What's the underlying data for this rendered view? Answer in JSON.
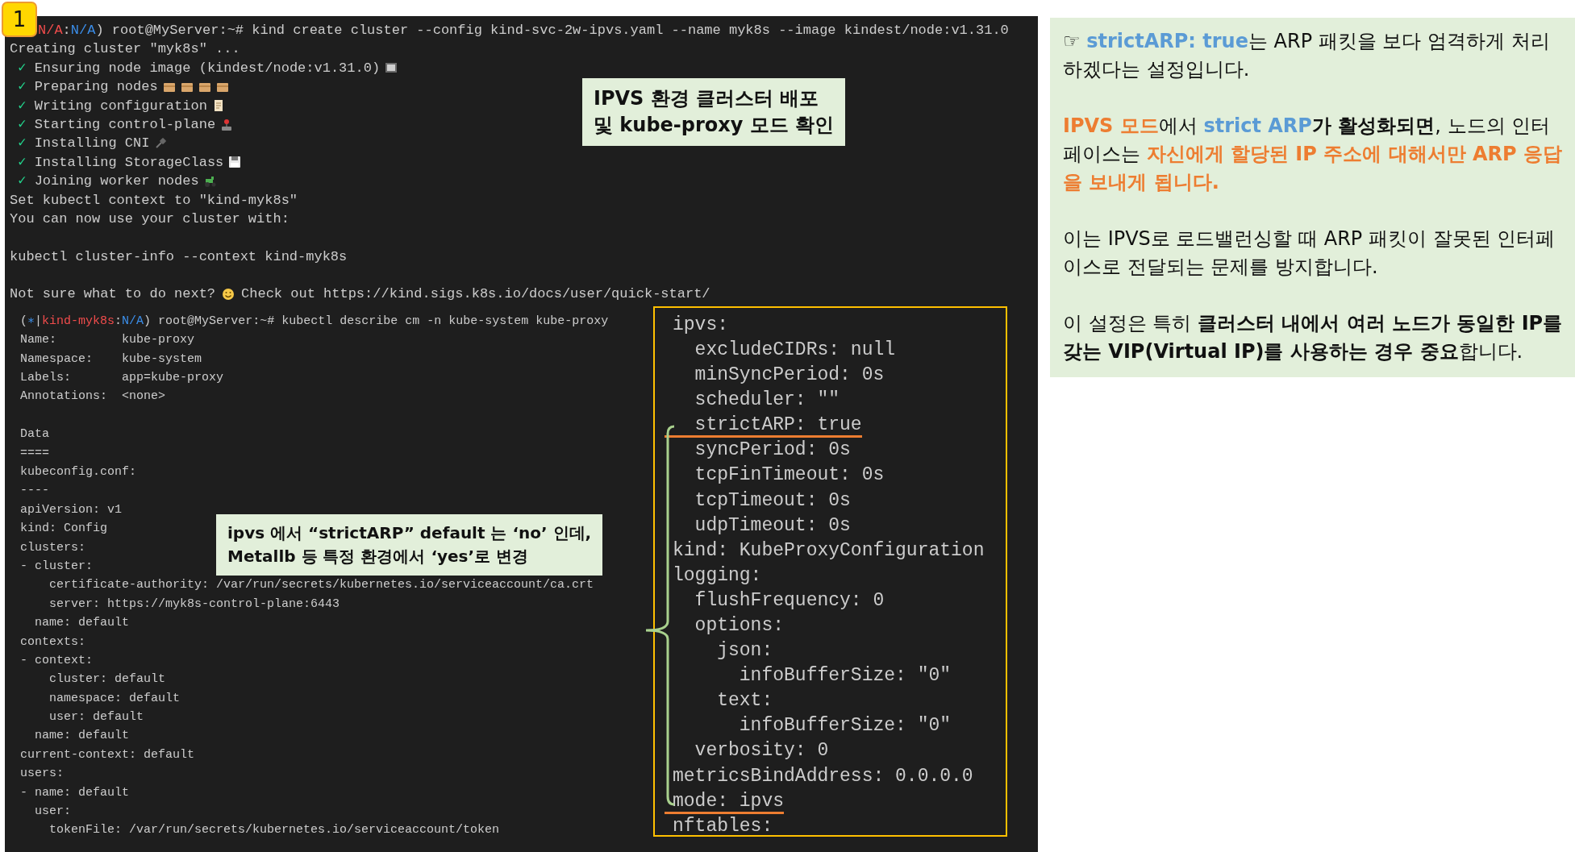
{
  "badge": "1",
  "terminal": {
    "create_output": [
      [
        [
          {
            "text": "N/A",
            "kind": "red"
          },
          {
            "text": ":",
            "kind": "text"
          },
          {
            "text": "N/A",
            "kind": "blue"
          },
          {
            "text": ") root@MyServer:~# kind create cluster --config kind-svc-2w-ipvs.yaml --name myk8s --image kindest/node:v1.31.0",
            "kind": "text"
          }
        ],
        [
          {
            "text": "Creating cluster \"myk8s\" ...",
            "kind": "text"
          }
        ],
        [
          {
            "text": " ✓ ",
            "kind": "check"
          },
          {
            "text": "Ensuring node image (kindest/node:v1.31.0)",
            "kind": "text"
          }
        ],
        [
          {
            "text": " ✓ ",
            "kind": "check"
          },
          {
            "text": "Preparing nodes",
            "kind": "text"
          }
        ],
        [
          {
            "text": " ✓ ",
            "kind": "check"
          },
          {
            "text": "Writing configuration",
            "kind": "text"
          }
        ],
        [
          {
            "text": " ✓ ",
            "kind": "check"
          },
          {
            "text": "Starting control-plane",
            "kind": "text"
          }
        ],
        [
          {
            "text": " ✓ ",
            "kind": "check"
          },
          {
            "text": "Installing CNI",
            "kind": "text"
          }
        ],
        [
          {
            "text": " ✓ ",
            "kind": "check"
          },
          {
            "text": "Installing StorageClass",
            "kind": "text"
          }
        ],
        [
          {
            "text": " ✓ ",
            "kind": "check"
          },
          {
            "text": "Joining worker nodes",
            "kind": "text"
          }
        ],
        [
          {
            "text": "Set kubectl context to \"kind-myk8s\"",
            "kind": "text"
          }
        ],
        [
          {
            "text": "You can now use your cluster with:",
            "kind": "text"
          }
        ]
      ],
      [
        [
          {
            "text": "kubectl cluster-info --context kind-myk8s",
            "kind": "text"
          }
        ]
      ],
      [
        [
          {
            "text": "Not sure what to do next?",
            "kind": "text"
          },
          {
            "text": "Check out https://kind.sigs.k8s.io/docs/user/quick-start/",
            "kind": "text"
          }
        ]
      ]
    ],
    "describe_prompt": [
      {
        "text": "(",
        "kind": "text"
      },
      {
        "text": "∗",
        "kind": "blue"
      },
      {
        "text": "|",
        "kind": "text"
      },
      {
        "text": "kind-myk8s",
        "kind": "red"
      },
      {
        "text": ":",
        "kind": "text"
      },
      {
        "text": "N/A",
        "kind": "blue"
      },
      {
        "text": ") root@MyServer:~# kubectl describe cm -n kube-system kube-proxy",
        "kind": "text"
      }
    ],
    "describe_output": [
      [
        "Name:         kube-proxy",
        "Namespace:    kube-system",
        "Labels:       app=kube-proxy",
        "Annotations:  <none>"
      ],
      [
        "Data",
        "====",
        "kubeconfig.conf:",
        "----",
        "apiVersion: v1",
        "kind: Config",
        "clusters:",
        "- cluster:",
        "    certificate-authority: /var/run/secrets/kubernetes.io/serviceaccount/ca.crt",
        "    server: https://myk8s-control-plane:6443",
        "  name: default",
        "contexts:",
        "- context:",
        "    cluster: default",
        "    namespace: default",
        "    user: default",
        "  name: default",
        "current-context: default",
        "users:",
        "- name: default",
        "  user:",
        "    tokenFile: /var/run/secrets/kubernetes.io/serviceaccount/token"
      ]
    ],
    "highlight_box": [
      {
        "text": "ipvs:",
        "underlined": false
      },
      {
        "text": "  excludeCIDRs: null",
        "underlined": false
      },
      {
        "text": "  minSyncPeriod: 0s",
        "underlined": false
      },
      {
        "text": "  scheduler: \"\"",
        "underlined": false
      },
      {
        "text": "  strictARP: true",
        "underlined": true
      },
      {
        "text": "  syncPeriod: 0s",
        "underlined": false
      },
      {
        "text": "  tcpFinTimeout: 0s",
        "underlined": false
      },
      {
        "text": "  tcpTimeout: 0s",
        "underlined": false
      },
      {
        "text": "  udpTimeout: 0s",
        "underlined": false
      },
      {
        "text": "kind: KubeProxyConfiguration",
        "underlined": false
      },
      {
        "text": "logging:",
        "underlined": false
      },
      {
        "text": "  flushFrequency: 0",
        "underlined": false
      },
      {
        "text": "  options:",
        "underlined": false
      },
      {
        "text": "    json:",
        "underlined": false
      },
      {
        "text": "      infoBufferSize: \"0\"",
        "underlined": false
      },
      {
        "text": "    text:",
        "underlined": false
      },
      {
        "text": "      infoBufferSize: \"0\"",
        "underlined": false
      },
      {
        "text": "  verbosity: 0",
        "underlined": false
      },
      {
        "text": "metricsBindAddress: 0.0.0.0",
        "underlined": false
      },
      {
        "text": "mode: ipvs",
        "underlined": true
      },
      {
        "text": "nftables:",
        "underlined": false
      }
    ]
  },
  "callouts": [
    [
      "IPVS 환경 클러스터 배포",
      "및 kube-proxy 모드 확인"
    ],
    [
      "ipvs 에서 “strictARP” default 는 ‘no’ 인데,",
      "Metallb 등 특정 환경에서 ‘yes’로 변경"
    ]
  ],
  "notes": [
    [
      {
        "text": "☞ ",
        "kind": "text"
      },
      {
        "text": "strictARP: true",
        "kind": "blue"
      },
      {
        "text": "는 ARP 패킷을 보다 엄격하게 처리하겠다는 설정입니다.",
        "kind": "text"
      }
    ],
    [
      {
        "text": "IPVS 모드",
        "kind": "orange"
      },
      {
        "text": "에서 ",
        "kind": "text"
      },
      {
        "text": "strict ARP",
        "kind": "blue"
      },
      {
        "text": "가 활성화되면",
        "kind": "bold"
      },
      {
        "text": ", 노드의 인터페이스는 ",
        "kind": "text"
      },
      {
        "text": "자신에게 할당된 IP 주소에 대해서만 ARP 응답을 보내게 됩니다.",
        "kind": "orange"
      }
    ],
    [
      {
        "text": "이는 IPVS로 로드밸런싱할 때 ARP 패킷이 잘못된 인터페이스로 전달되는 문제를 방지합니다.",
        "kind": "text"
      }
    ],
    [
      {
        "text": "이 설정은 특히 ",
        "kind": "text"
      },
      {
        "text": "클러스터 내에서 여러 노드가 동일한 IP를 갖는 VIP(Virtual IP)를 사용하는 경우 중요",
        "kind": "bold"
      },
      {
        "text": "합니다.",
        "kind": "text"
      }
    ]
  ]
}
